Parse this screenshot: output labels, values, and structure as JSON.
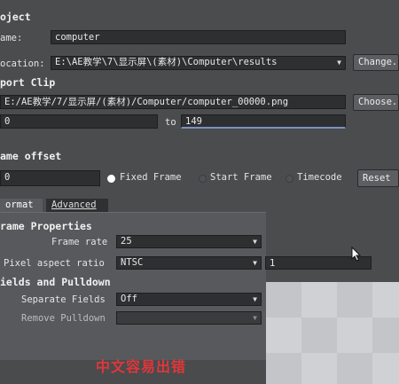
{
  "project": {
    "header": "oject",
    "name_label": "ame:",
    "name_value": "computer",
    "location_label": "ocation:",
    "location_value": "E:\\AE教学\\7\\显示屏\\(素材)\\Computer\\results",
    "change_button": "Change.."
  },
  "export_clip": {
    "header": "port Clip",
    "path_value": "E:/AE教学/7/显示屏/(素材)/Computer/computer_00000.png",
    "choose_button": "Choose..",
    "from_value": "0",
    "to_label": "to",
    "to_value": "149"
  },
  "frame_offset": {
    "header": "ame offset",
    "value": "0",
    "options": [
      {
        "label": "Fixed Frame",
        "selected": true
      },
      {
        "label": "Start Frame",
        "selected": false
      },
      {
        "label": "Timecode",
        "selected": false
      }
    ],
    "reset_button": "Reset"
  },
  "tabs": [
    {
      "label": "ormat",
      "active": true
    },
    {
      "label": "Advanced",
      "active": false
    }
  ],
  "format": {
    "frame_properties_header": "rame Properties",
    "frame_rate_label": "Frame rate",
    "frame_rate_value": "25",
    "pixel_aspect_label": "Pixel aspect ratio",
    "pixel_aspect_value": "NTSC",
    "pixel_aspect_number": "1",
    "fields_header": "ields and Pulldown",
    "separate_fields_label": "Separate Fields",
    "separate_fields_value": "Off",
    "remove_pulldown_label": "Remove Pulldown",
    "remove_pulldown_value": ""
  },
  "watermark": "中文容易出错",
  "colors": {
    "dialog_bg": "#4b4c4e",
    "field_bg": "#2e2f31",
    "accent_underline": "#7d8fc2",
    "watermark": "#e0363a"
  }
}
